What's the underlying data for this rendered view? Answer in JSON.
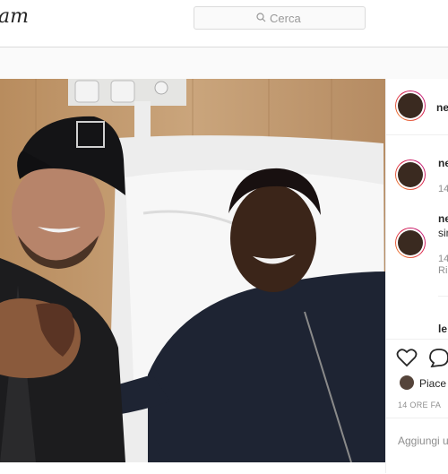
{
  "header": {
    "brand_fragment": "am",
    "search_placeholder": "Cerca"
  },
  "sidebar": {
    "owner_name": "ne",
    "comments": [
      {
        "username": "ne",
        "time": "14"
      },
      {
        "username": "ne",
        "text": "sin",
        "time": "14",
        "reply": "Ri"
      },
      {
        "username": "le"
      }
    ],
    "likes_label": "Piace",
    "timestamp": "14 ORE FA",
    "add_comment": "Aggiungi u"
  },
  "colors": {
    "story_ring": "#dc2743",
    "border": "#dbdbdb"
  }
}
